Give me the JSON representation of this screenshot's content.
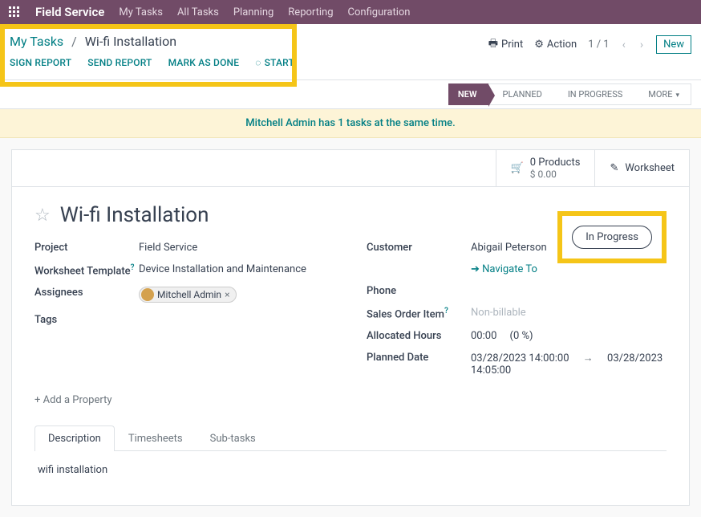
{
  "topbar": {
    "brand": "Field Service",
    "nav": [
      "My Tasks",
      "All Tasks",
      "Planning",
      "Reporting",
      "Configuration"
    ]
  },
  "breadcrumb": {
    "parent": "My Tasks",
    "current": "Wi-fi Installation"
  },
  "actions": {
    "sign": "SIGN REPORT",
    "send": "SEND REPORT",
    "done": "MARK AS DONE",
    "start": "START"
  },
  "header_right": {
    "print": "Print",
    "action": "Action",
    "pager": "1 / 1",
    "new": "New"
  },
  "status_steps": {
    "new": "NEW",
    "planned": "PLANNED",
    "in_progress": "IN PROGRESS",
    "more": "MORE"
  },
  "banner": "Mitchell Admin has 1 tasks at the same time.",
  "card_top": {
    "products_line1": "0 Products",
    "products_line2": "$ 0.00",
    "worksheet": "Worksheet"
  },
  "task": {
    "title": "Wi-fi Installation",
    "status_badge": "In Progress"
  },
  "fields_left": {
    "project_label": "Project",
    "project_value": "Field Service",
    "worksheet_label": "Worksheet Template",
    "worksheet_value": "Device Installation and Maintenance",
    "assignees_label": "Assignees",
    "assignee_tag": "Mitchell Admin",
    "tags_label": "Tags"
  },
  "fields_right": {
    "customer_label": "Customer",
    "customer_value": "Abigail Peterson",
    "navigate": "Navigate To",
    "phone_label": "Phone",
    "soi_label": "Sales Order Item",
    "soi_value": "Non-billable",
    "alloc_label": "Allocated Hours",
    "alloc_hours": "00:00",
    "alloc_pct": "(0 %)",
    "planned_label": "Planned Date",
    "planned_start": "03/28/2023 14:00:00",
    "planned_end": "03/28/2023 14:05:00"
  },
  "add_property": "Add a Property",
  "tabs": {
    "description": "Description",
    "timesheets": "Timesheets",
    "subtasks": "Sub-tasks"
  },
  "description_content": "wifi installation"
}
